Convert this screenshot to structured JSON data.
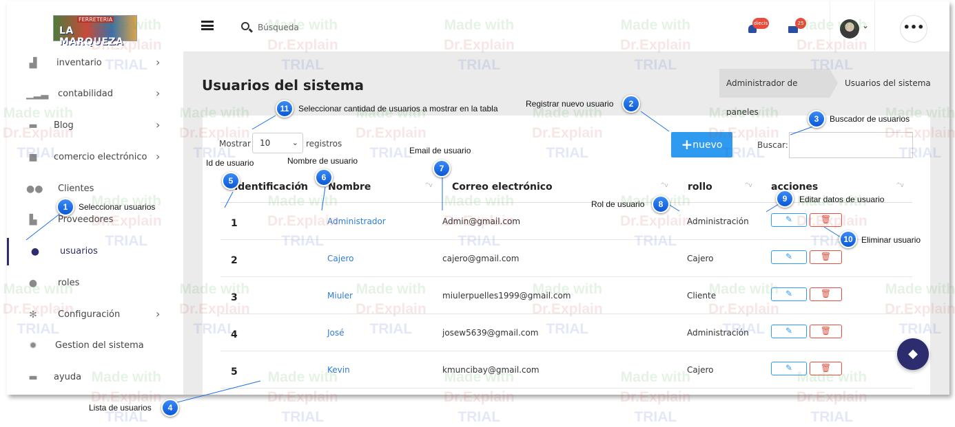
{
  "brand": {
    "logo_line1": "FERRETERIA",
    "logo_line2": "LA MARQUEZA"
  },
  "sidebar": {
    "items": [
      {
        "label": "inventario",
        "icon": "warehouse-icon",
        "chevron": true
      },
      {
        "label": "contabilidad",
        "icon": "signal-bars-icon",
        "chevron": true
      },
      {
        "label": "Blog",
        "icon": "document-icon",
        "chevron": true
      },
      {
        "label": "comercio electrónico",
        "icon": "shopping-bag-icon",
        "chevron": true
      },
      {
        "label": "Clientes",
        "icon": "users-icon",
        "chevron": false
      },
      {
        "label": "Proveedores",
        "icon": "truck-icon",
        "chevron": false
      },
      {
        "label": "usuarios",
        "icon": "user-gear-icon",
        "chevron": false,
        "active": true
      },
      {
        "label": "roles",
        "icon": "user-gear-icon",
        "chevron": false
      },
      {
        "label": "Configuración",
        "icon": "cogs-icon",
        "chevron": true
      },
      {
        "label": "Gestion del sistema",
        "icon": "gear-icon",
        "chevron": false
      },
      {
        "label": "ayuda",
        "icon": "book-icon",
        "chevron": false
      }
    ]
  },
  "topbar": {
    "search_placeholder": "Búsqueda",
    "notifications_badge": "diecis",
    "messages_badge": "25"
  },
  "page": {
    "title": "Usuarios del sistema",
    "breadcrumb": [
      "Administrador de paneles",
      "Usuarios del sistema"
    ]
  },
  "table_controls": {
    "show_label": "Mostrar",
    "show_value": "10",
    "records_label": "registros",
    "new_button": "nuevo",
    "search_label": "Buscar:"
  },
  "table": {
    "columns": [
      "Identificación",
      "Nombre",
      "Correo electrónico",
      "rollo",
      "acciones"
    ],
    "rows": [
      {
        "id": "1",
        "name": "Administrador",
        "email": "Admin@gmail.com",
        "role": "Administración"
      },
      {
        "id": "2",
        "name": "Cajero",
        "email": "cajero@gmail.com",
        "role": "Cajero"
      },
      {
        "id": "3",
        "name": "Miuler",
        "email": "miulerpuelles1999@gmail.com",
        "role": "Cliente"
      },
      {
        "id": "4",
        "name": "José",
        "email": "josew5639@gmail.com",
        "role": "Administración"
      },
      {
        "id": "5",
        "name": "Kevin",
        "email": "kmuncibay@gmail.com",
        "role": "Cajero"
      }
    ]
  },
  "watermark": {
    "line1": "Made with",
    "line2": "Dr.Explain",
    "line3": "TRIAL"
  },
  "annotations": [
    {
      "num": "1",
      "text": "Seleccionar usuarios"
    },
    {
      "num": "2",
      "text": "Registrar nuevo usuario"
    },
    {
      "num": "3",
      "text": "Buscador de usuarios"
    },
    {
      "num": "4",
      "text": "Lista de usuarios"
    },
    {
      "num": "5",
      "text": "Id de usuario"
    },
    {
      "num": "6",
      "text": "Nombre de usuario"
    },
    {
      "num": "7",
      "text": "Email de usuario"
    },
    {
      "num": "8",
      "text": "Rol de usuario"
    },
    {
      "num": "9",
      "text": "Editar datos de usuario"
    },
    {
      "num": "10",
      "text": "Eliminar usuario"
    },
    {
      "num": "11",
      "text": "Seleccionar cantidad de usuarios a mostrar en la tabla"
    }
  ],
  "colors": {
    "accent": "#2e9bf0",
    "danger": "#e74c3c",
    "sidebar_active": "#2c2c6e",
    "callout": "#1a6fe8"
  }
}
